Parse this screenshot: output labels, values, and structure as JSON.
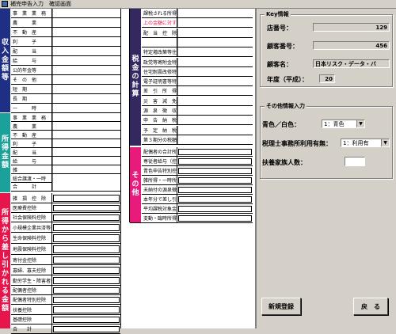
{
  "window": {
    "title": "補完申告入力　確認画面"
  },
  "colors": {
    "navy": "#1f2f86",
    "teal": "#1aa29a",
    "red": "#e8154c",
    "purple": "#35275f",
    "pink": "#e81a7c"
  },
  "col1": {
    "cats": [
      {
        "chars": [
          "収",
          "入",
          "金",
          "額",
          "等"
        ]
      },
      {
        "chars": [
          "所",
          "得",
          "金",
          "額"
        ]
      },
      {
        "chars": [
          "所",
          "得",
          "か",
          "ら",
          "差",
          "し",
          "引",
          "か",
          "れ",
          "る",
          "金",
          "額"
        ]
      }
    ],
    "rows": [
      "事　業　業　務",
      "農　　　業",
      "不　動　産",
      "利　　　子",
      "配　　　当",
      "給　　　与",
      "公的年金等",
      "そ　の　他",
      "短　期",
      "長　期",
      "一　　　時",
      "事　業　業　務",
      "農　　　業",
      "不　動　産",
      "利　　　子",
      "配　　　当",
      "給　　　与",
      "雑",
      "総合譲渡・一時",
      "合　　　計",
      "雑　損　控　除",
      "医療費控除",
      "社会保険料控除",
      "小規模企業共済等掛金控除",
      "生命保険料控除",
      "地震保険料控除",
      "寄付金控除",
      "寡婦、寡夫控除",
      "勤労学生・障害者控除",
      "配偶者控除",
      "配偶者特別控除",
      "扶養控除",
      "基礎控除",
      "合　　計"
    ]
  },
  "col2": {
    "cats": [
      {
        "chars": [
          "税",
          "金",
          "の",
          "計",
          "算"
        ]
      },
      {
        "chars": [
          "そ",
          "の",
          "他"
        ]
      }
    ],
    "rows": [
      "課税される所得金額",
      "上の金額に対する税額",
      "配　当　控　除",
      "",
      "特定増改築等住宅借入金等特別控除",
      "政党等寄附金特別控除",
      "住宅耐震改修特別控除",
      "電子証明書等特別控除",
      "差　引　所　得　税　額",
      "災　害　減　免　額",
      "源　泉　徴　収　税　額",
      "申　告　納　税　額",
      "予　定　納　税　額",
      "第３期分の税額",
      "配偶者の合計所得金額",
      "専従者給与（控除）額の合計額",
      "青色申告特別控除額",
      "雑所得・一時所得等の源泉徴収税額",
      "未納付の源泉徴収税額",
      "本年分で差し引く繰越損失額",
      "平均課税対象金額",
      "変動・臨時所得金額"
    ]
  },
  "panel": {
    "key_title": "Key情報",
    "store_label": "店番号：",
    "store_value": "129",
    "client_label": "顧客番号：",
    "client_value": "456",
    "name_label": "顧客名：",
    "name_value": "日本リスク・データ・バ",
    "year_label": "年度（平成）：",
    "year_value": "20",
    "other_title": "その他情報入力",
    "blue_label": "青色／白色：",
    "blue_value": "1：青色",
    "tax_label": "税理士事務所利用有無：",
    "tax_value": "1：利用有",
    "dep_label": "扶養家族人数：",
    "dep_value": "",
    "new_button": "新規登録",
    "back_button": "戻　る"
  }
}
